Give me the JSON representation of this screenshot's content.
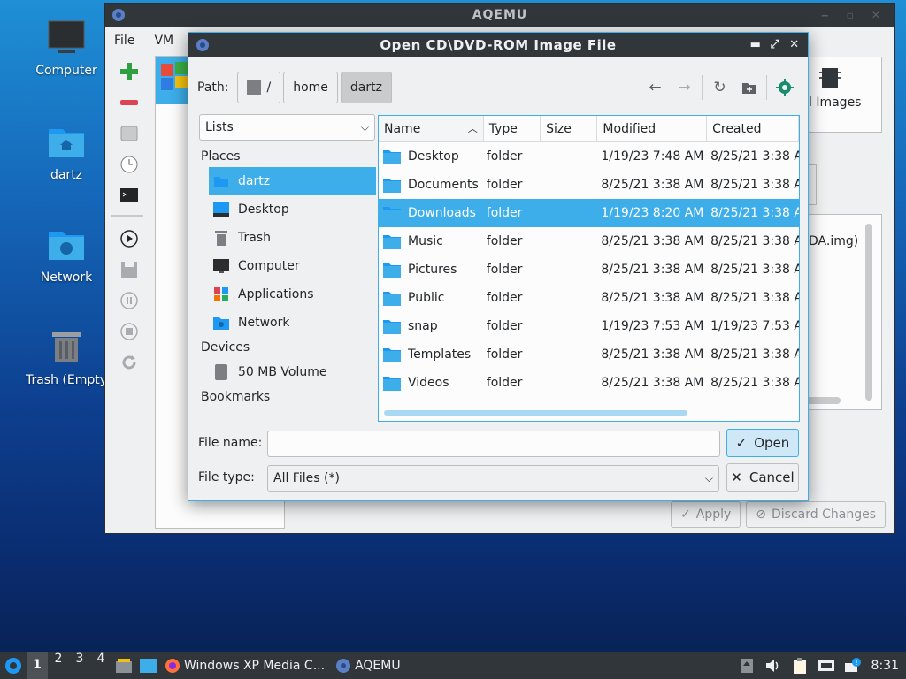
{
  "desktop": {
    "icons": [
      {
        "label": "Computer"
      },
      {
        "label": "dartz"
      },
      {
        "label": "Network"
      },
      {
        "label": "Trash (Empty"
      }
    ]
  },
  "aqemu": {
    "title": "AQEMU",
    "menu": [
      "File",
      "VM"
    ],
    "right_panel_text": "l Images",
    "side_text": "DA.img)",
    "apply_label": "Apply",
    "discard_label": "Discard Changes"
  },
  "dialog": {
    "title": "Open CD\\DVD-ROM Image File",
    "path_label": "Path:",
    "crumbs": [
      "/",
      "home",
      "dartz"
    ],
    "view_mode": "Lists",
    "places_heading": "Places",
    "places": [
      "dartz",
      "Desktop",
      "Trash",
      "Computer",
      "Applications",
      "Network"
    ],
    "devices_heading": "Devices",
    "devices": [
      "50 MB Volume"
    ],
    "bookmarks_heading": "Bookmarks",
    "columns": [
      "Name",
      "Type",
      "Size",
      "Modified",
      "Created"
    ],
    "files": [
      {
        "name": "Desktop",
        "type": "folder",
        "size": "",
        "modified": "1/19/23 7:48 AM",
        "created": "8/25/21 3:38 A"
      },
      {
        "name": "Documents",
        "type": "folder",
        "size": "",
        "modified": "8/25/21 3:38 AM",
        "created": "8/25/21 3:38 A"
      },
      {
        "name": "Downloads",
        "type": "folder",
        "size": "",
        "modified": "1/19/23 8:20 AM",
        "created": "8/25/21 3:38 A"
      },
      {
        "name": "Music",
        "type": "folder",
        "size": "",
        "modified": "8/25/21 3:38 AM",
        "created": "8/25/21 3:38 A"
      },
      {
        "name": "Pictures",
        "type": "folder",
        "size": "",
        "modified": "8/25/21 3:38 AM",
        "created": "8/25/21 3:38 A"
      },
      {
        "name": "Public",
        "type": "folder",
        "size": "",
        "modified": "8/25/21 3:38 AM",
        "created": "8/25/21 3:38 A"
      },
      {
        "name": "snap",
        "type": "folder",
        "size": "",
        "modified": "1/19/23 7:53 AM",
        "created": "1/19/23 7:53 A"
      },
      {
        "name": "Templates",
        "type": "folder",
        "size": "",
        "modified": "8/25/21 3:38 AM",
        "created": "8/25/21 3:38 A"
      },
      {
        "name": "Videos",
        "type": "folder",
        "size": "",
        "modified": "8/25/21 3:38 AM",
        "created": "8/25/21 3:38 A"
      }
    ],
    "selected_file": "Downloads",
    "file_name_label": "File name:",
    "file_name_value": "",
    "file_type_label": "File type:",
    "file_type_value": "All Files (*)",
    "open_label": "Open",
    "cancel_label": "Cancel"
  },
  "taskbar": {
    "workspaces": [
      "1",
      "2",
      "3",
      "4"
    ],
    "active_workspace": "1",
    "tasks": [
      {
        "label": "Windows XP Media C...",
        "icon": "firefox-icon"
      },
      {
        "label": "AQEMU",
        "icon": "aqemu-icon"
      }
    ],
    "clock": "8:31"
  },
  "colors": {
    "accent": "#3daee9",
    "titlebar": "#31363b",
    "window_bg": "#eff0f1"
  }
}
